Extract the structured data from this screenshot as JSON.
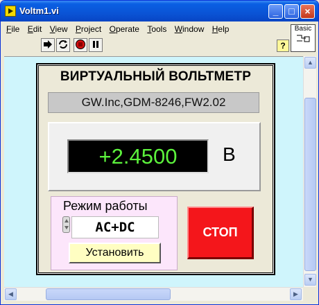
{
  "window": {
    "title": "Voltm1.vi",
    "controls": {
      "minimize": "_",
      "maximize": "□",
      "close": "×"
    }
  },
  "menu": {
    "items": [
      {
        "first": "F",
        "rest": "ile"
      },
      {
        "first": "E",
        "rest": "dit"
      },
      {
        "first": "V",
        "rest": "iew"
      },
      {
        "first": "P",
        "rest": "roject"
      },
      {
        "first": "O",
        "rest": "perate"
      },
      {
        "first": "T",
        "rest": "ools"
      },
      {
        "first": "W",
        "rest": "indow"
      },
      {
        "first": "H",
        "rest": "elp"
      }
    ]
  },
  "toolbar": {
    "run_icon": "run-arrow-icon",
    "run_continuous_icon": "run-continuously-icon",
    "abort_icon": "abort-icon",
    "pause_icon": "pause-icon",
    "help_label": "?",
    "palette_label": "Basic"
  },
  "front_panel": {
    "title": "ВИРТУАЛЬНЫЙ ВОЛЬТМЕТР",
    "device_id": "GW.Inc,GDM-8246,FW2.02",
    "reading": "+2.4500",
    "unit": "В",
    "mode_label": "Режим работы",
    "mode_value": "AC+DC",
    "set_button": "Установить",
    "stop_button": "СТОП"
  },
  "colors": {
    "panel_background": "#CFF5FC",
    "readout_text": "#5CF23C",
    "stop_button": "#F4161B",
    "mode_box": "#FCE6FB"
  }
}
